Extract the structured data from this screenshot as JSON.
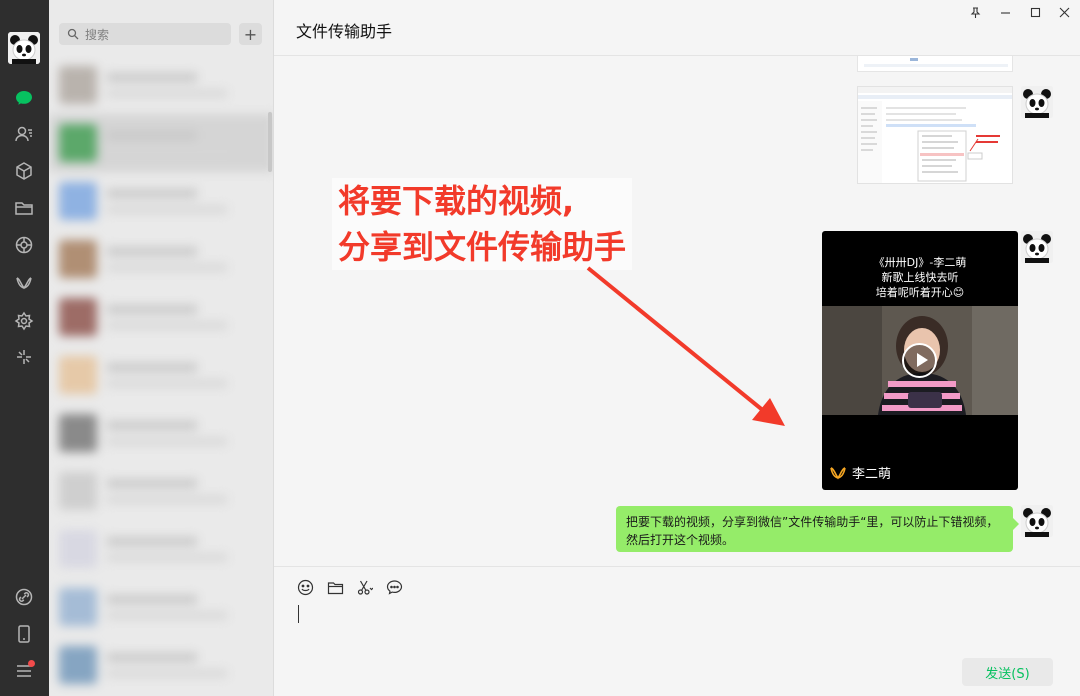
{
  "search": {
    "placeholder": "搜索",
    "add_label": "+"
  },
  "chat": {
    "title": "文件传输助手"
  },
  "video": {
    "caption_lines": [
      "《卅卅DJ》-李二萌",
      "新歌上线快去听",
      "培着呢听着开心😊"
    ],
    "author": "李二萌"
  },
  "message": {
    "text": "把要下载的视频，分享到微信”文件传输助手“里，可以防止下错视频，然后打开这个视频。"
  },
  "annotation": {
    "line1": "将要下载的视频,",
    "line2": "分享到文件传输助手"
  },
  "input": {
    "send_label": "发送(S)"
  },
  "colors": {
    "accent_green": "#07c160",
    "bubble_green": "#95ec69",
    "annotation_red": "#f23a2a",
    "rail_bg": "#2e2e2e"
  },
  "icons": [
    "chat-icon",
    "contacts-icon",
    "favorites-icon",
    "folder-icon",
    "moments-icon",
    "channels-icon",
    "search-feature-icon",
    "miniprogram-icon",
    "link-icon",
    "phone-icon",
    "menu-icon",
    "emoji-icon",
    "file-icon",
    "screenshot-icon",
    "history-icon"
  ]
}
